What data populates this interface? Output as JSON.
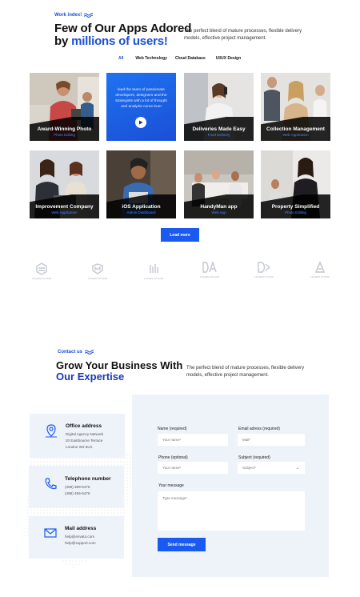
{
  "apps_section": {
    "tagline": "Work index!",
    "title_line1": "Few of Our Apps Adored",
    "title_by": "by",
    "title_accent": "millions of users!",
    "description": "The perfect blend of mature processes, flexible delivery models, effective project management."
  },
  "filters": [
    {
      "label": "All",
      "active": true
    },
    {
      "label": "Web Technology",
      "active": false
    },
    {
      "label": "Cloud Database",
      "active": false
    },
    {
      "label": "UI/UX Design",
      "active": false
    }
  ],
  "cards": [
    {
      "title": "Award-Winning Photo",
      "subtitle": "Photo Editing",
      "photo": "woman-laptop-office"
    },
    {
      "title": "",
      "subtitle": "",
      "promo_text": "lead the team of passionate developers, designers and the strategists with a lot of thought and analysis come true!",
      "icon": "play-icon"
    },
    {
      "title": "Deliveries Made Easy",
      "subtitle": "Food Delivery",
      "photo": "woman-on-phone"
    },
    {
      "title": "Collection Management",
      "subtitle": "Web Application",
      "photo": "team-smiling"
    },
    {
      "title": "Improvement Company",
      "subtitle": "Web Application",
      "photo": "women-laptop"
    },
    {
      "title": "iOS Application",
      "subtitle": "Admin Dashboard",
      "photo": "woman-tablet"
    },
    {
      "title": "HandyMan app",
      "subtitle": "Web App",
      "photo": "team-meeting-table"
    },
    {
      "title": "Property Simplified",
      "subtitle": "Photo Editing",
      "photo": "businesswoman-presenting"
    }
  ],
  "load_more": "Load more",
  "logos": [
    {
      "icon": "hexagon-stack-logo",
      "label": "LOREM IPSUM"
    },
    {
      "icon": "m-shield-logo",
      "label": "LOREM IPSUM"
    },
    {
      "icon": "bars-logo",
      "label": "LOREM IPSUM"
    },
    {
      "icon": "da-logo",
      "label": "LOREM IPSUM"
    },
    {
      "icon": "d-arrow-logo",
      "label": "LOREM IPSUM"
    },
    {
      "icon": "a-triangle-logo",
      "label": "LOREM IPSUM"
    }
  ],
  "contact_section": {
    "tagline": "Contact us",
    "title_line1": "Grow Your Business With",
    "title_accent": "Our Expertise",
    "description": "The perfect blend of mature processes, flexible delivery models, effective project management."
  },
  "info": {
    "office": {
      "title": "Office address",
      "lines": [
        "Digital Agency Network",
        "20 Eastbourne Terrace",
        "London W2 6LG"
      ],
      "icon": "location-pin-icon"
    },
    "phone": {
      "title": "Telephone number",
      "lines": [
        "(488) 389-5476",
        "(488) 456-5476"
      ],
      "icon": "phone-icon"
    },
    "mail": {
      "title": "Mail address",
      "lines": [
        "help@envato.com",
        "help@support.com"
      ],
      "icon": "mail-icon"
    }
  },
  "form": {
    "name_label": "Name (required)",
    "name_placeholder": "Your name*",
    "email_label": "Email adress (required)",
    "email_placeholder": "Mail*",
    "phone_label": "Phone (optional)",
    "phone_placeholder": "Your name*",
    "subject_label": "Subject (required)",
    "subject_placeholder": "Subject*",
    "message_label": "Your message",
    "message_placeholder": "Type message*",
    "submit": "Send message"
  },
  "colors": {
    "accent": "#1a4fd8",
    "button": "#1a5af0",
    "panel": "#eef2f9"
  }
}
